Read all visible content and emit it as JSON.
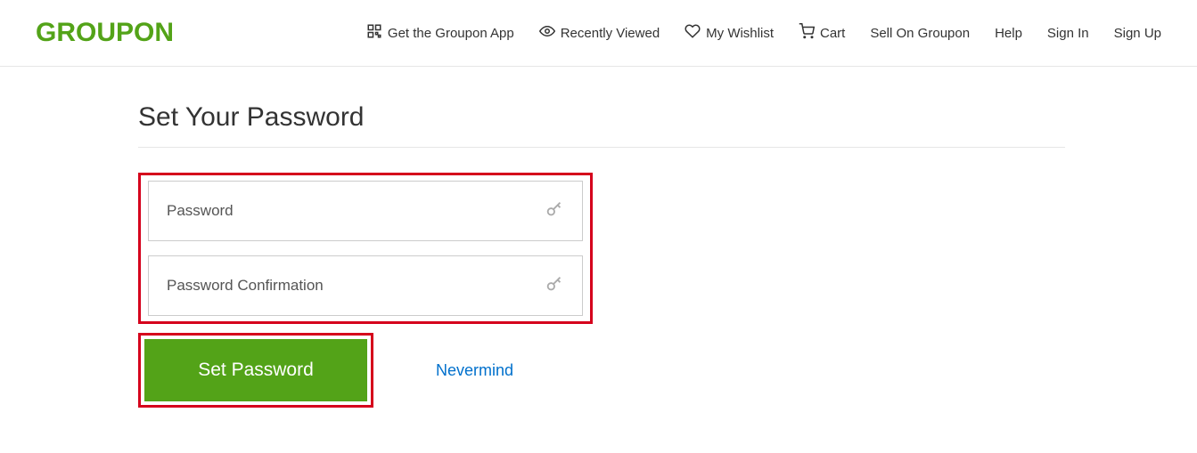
{
  "brand": {
    "logo": "GROUPON"
  },
  "nav": {
    "get_app": "Get the Groupon App",
    "recently_viewed": "Recently Viewed",
    "wishlist": "My Wishlist",
    "cart": "Cart",
    "sell": "Sell On Groupon",
    "help": "Help",
    "sign_in": "Sign In",
    "sign_up": "Sign Up"
  },
  "page": {
    "title": "Set Your Password",
    "password_placeholder": "Password",
    "confirm_placeholder": "Password Confirmation",
    "submit_label": "Set Password",
    "cancel_label": "Nevermind"
  },
  "colors": {
    "brand_green": "#53a318",
    "highlight_red": "#d5001c",
    "link_blue": "#0070cc"
  }
}
